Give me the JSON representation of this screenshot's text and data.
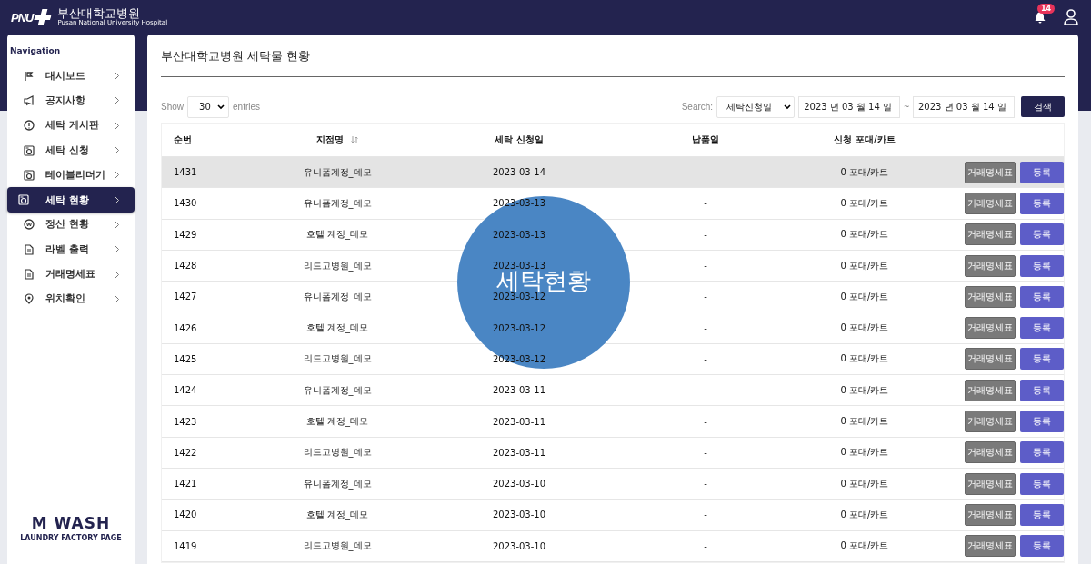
{
  "header": {
    "logo_mark": "PNU",
    "logo_title": "부산대학교병원",
    "logo_subtitle": "Pusan National University Hospital",
    "notification_count": "14"
  },
  "sidebar": {
    "heading": "Navigation",
    "items": [
      {
        "label": "대시보드",
        "selected": false
      },
      {
        "label": "공지사항",
        "selected": false
      },
      {
        "label": "세탁 게시판",
        "selected": false
      },
      {
        "label": "세탁 신청",
        "selected": false
      },
      {
        "label": "테이블리더기",
        "selected": false
      },
      {
        "label": "세탁 현황",
        "selected": true
      },
      {
        "label": "정산 현황",
        "selected": false
      },
      {
        "label": "라벨 출력",
        "selected": false
      },
      {
        "label": "거래명세표",
        "selected": false
      },
      {
        "label": "위치확인",
        "selected": false
      }
    ],
    "brand": "M WASH",
    "brand_subtitle": "LAUNDRY FACTORY PAGE"
  },
  "page": {
    "title": "부산대학교병원 세탁물 현황",
    "show_label": "Show",
    "entries_value": "30",
    "entries_label": "entries",
    "search_label": "Search:",
    "search_field_value": "세탁신청일",
    "date_from": "2023 년 03 월 14 일",
    "date_separator": "~",
    "date_to": "2023 년 03 월 14 일",
    "search_button": "검색"
  },
  "table": {
    "columns": [
      "순번",
      "지점명",
      "세탁 신청일",
      "납품일",
      "신청 포대/카트"
    ],
    "rows": [
      {
        "no": "1431",
        "branch": "유니폼계정_데모",
        "request_date": "2023-03-14",
        "delivery_date": "-",
        "bags": "0 포대/카트",
        "statement_button": "거래명세표",
        "register_button": "등록",
        "selected": true
      },
      {
        "no": "1430",
        "branch": "유니폼계정_데모",
        "request_date": "2023-03-13",
        "delivery_date": "-",
        "bags": "0 포대/카트",
        "statement_button": "거래명세표",
        "register_button": "등록",
        "selected": false
      },
      {
        "no": "1429",
        "branch": "호텔 계정_데모",
        "request_date": "2023-03-13",
        "delivery_date": "-",
        "bags": "0 포대/카트",
        "statement_button": "거래명세표",
        "register_button": "등록",
        "selected": false
      },
      {
        "no": "1428",
        "branch": "리드고병원_데모",
        "request_date": "2023-03-13",
        "delivery_date": "-",
        "bags": "0 포대/카트",
        "statement_button": "거래명세표",
        "register_button": "등록",
        "selected": false
      },
      {
        "no": "1427",
        "branch": "유니폼계정_데모",
        "request_date": "2023-03-12",
        "delivery_date": "-",
        "bags": "0 포대/카트",
        "statement_button": "거래명세표",
        "register_button": "등록",
        "selected": false
      },
      {
        "no": "1426",
        "branch": "호텔 계정_데모",
        "request_date": "2023-03-12",
        "delivery_date": "-",
        "bags": "0 포대/카트",
        "statement_button": "거래명세표",
        "register_button": "등록",
        "selected": false
      },
      {
        "no": "1425",
        "branch": "리드고병원_데모",
        "request_date": "2023-03-12",
        "delivery_date": "-",
        "bags": "0 포대/카트",
        "statement_button": "거래명세표",
        "register_button": "등록",
        "selected": false
      },
      {
        "no": "1424",
        "branch": "유니폼계정_데모",
        "request_date": "2023-03-11",
        "delivery_date": "-",
        "bags": "0 포대/카트",
        "statement_button": "거래명세표",
        "register_button": "등록",
        "selected": false
      },
      {
        "no": "1423",
        "branch": "호텔 계정_데모",
        "request_date": "2023-03-11",
        "delivery_date": "-",
        "bags": "0 포대/카트",
        "statement_button": "거래명세표",
        "register_button": "등록",
        "selected": false
      },
      {
        "no": "1422",
        "branch": "리드고병원_데모",
        "request_date": "2023-03-11",
        "delivery_date": "-",
        "bags": "0 포대/카트",
        "statement_button": "거래명세표",
        "register_button": "등록",
        "selected": false
      },
      {
        "no": "1421",
        "branch": "유니폼계정_데모",
        "request_date": "2023-03-10",
        "delivery_date": "-",
        "bags": "0 포대/카트",
        "statement_button": "거래명세표",
        "register_button": "등록",
        "selected": false
      },
      {
        "no": "1420",
        "branch": "호텔 계정_데모",
        "request_date": "2023-03-10",
        "delivery_date": "-",
        "bags": "0 포대/카트",
        "statement_button": "거래명세표",
        "register_button": "등록",
        "selected": false
      },
      {
        "no": "1419",
        "branch": "리드고병원_데모",
        "request_date": "2023-03-10",
        "delivery_date": "-",
        "bags": "0 포대/카트",
        "statement_button": "거래명세표",
        "register_button": "등록",
        "selected": false
      }
    ]
  },
  "overlay": {
    "text": "세탁현황"
  }
}
